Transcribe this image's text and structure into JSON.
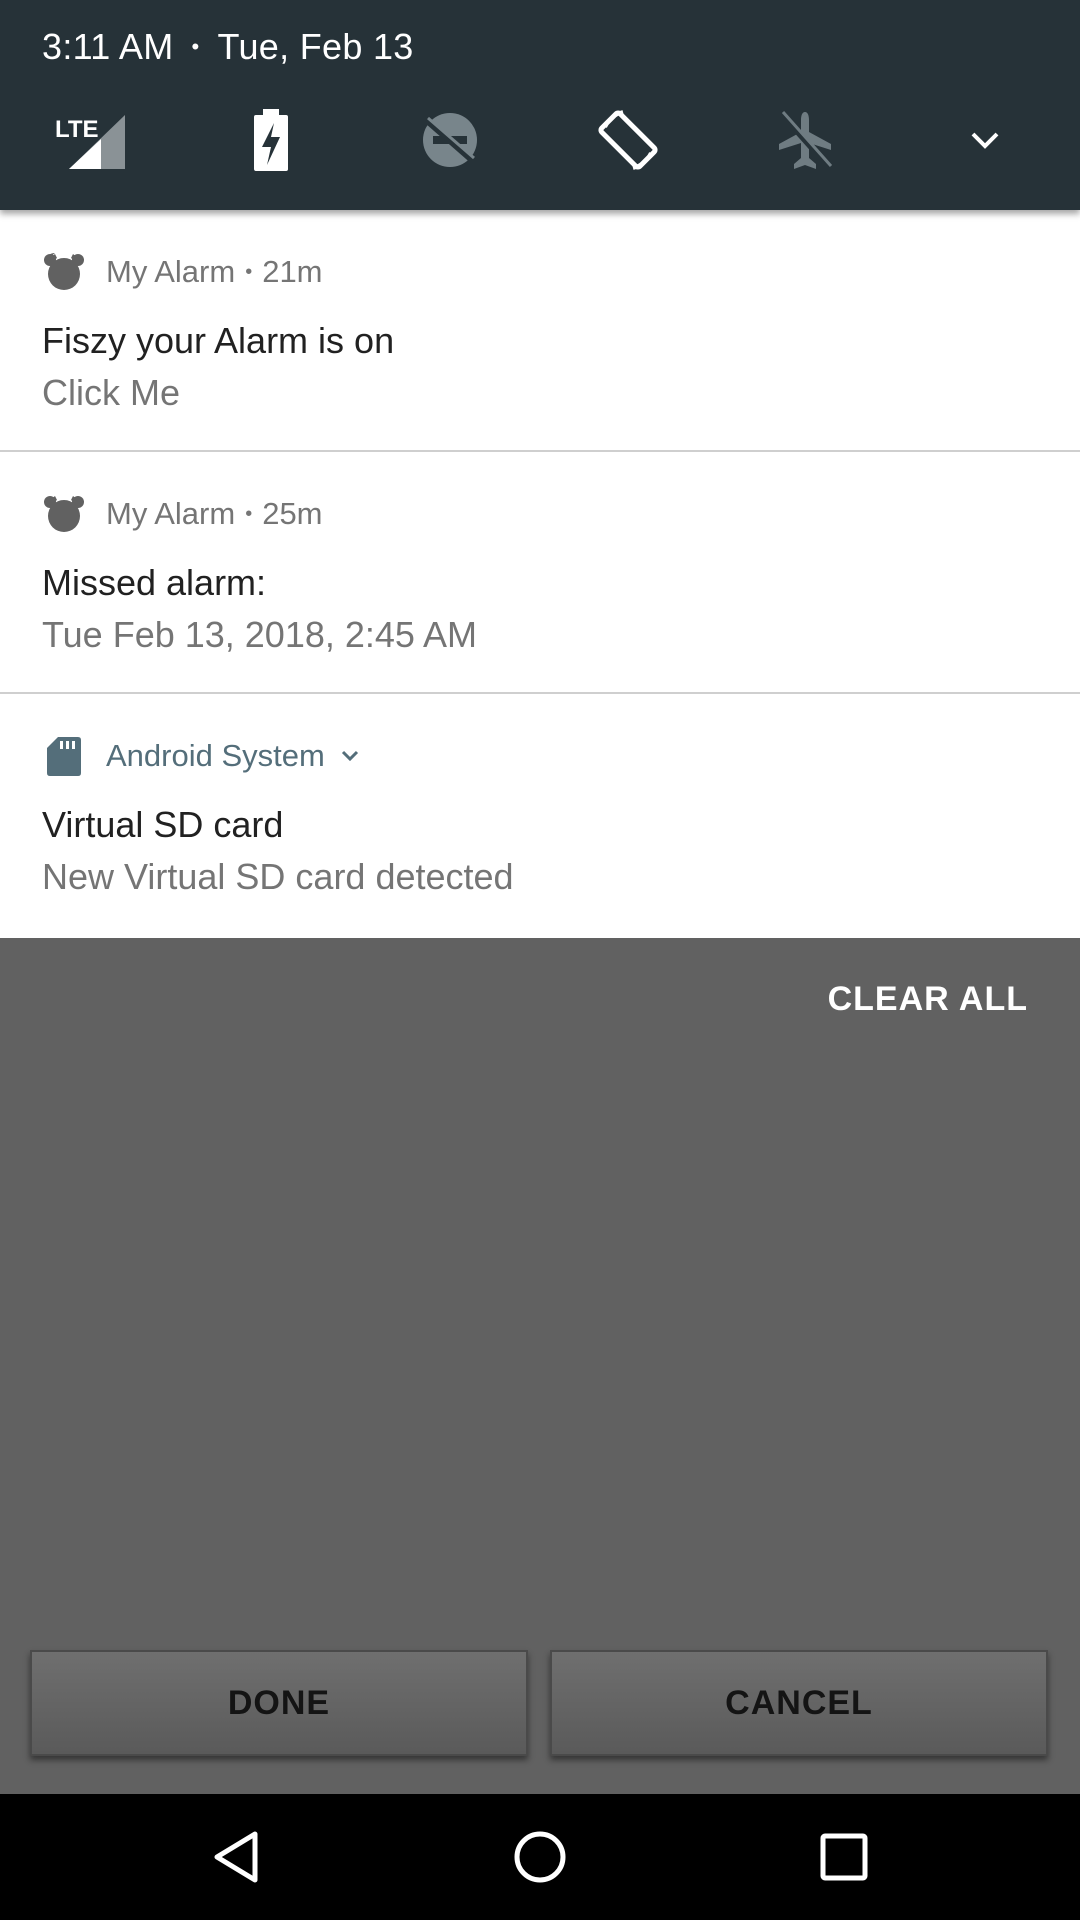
{
  "status": {
    "time": "3:11 AM",
    "separator": "•",
    "date": "Tue, Feb 13"
  },
  "quick_settings": {
    "tiles": [
      {
        "name": "signal-lte-icon",
        "label": "LTE"
      },
      {
        "name": "battery-charging-icon"
      },
      {
        "name": "do-not-disturb-off-icon"
      },
      {
        "name": "auto-rotate-icon"
      },
      {
        "name": "airplane-mode-off-icon"
      },
      {
        "name": "expand-chevron-icon"
      }
    ]
  },
  "notifications": [
    {
      "app": "My Alarm",
      "dot": "•",
      "time": "21m",
      "icon": "alarm-clock-icon",
      "title": "Fiszy your Alarm is on",
      "text": "Click Me"
    },
    {
      "app": "My Alarm",
      "dot": "•",
      "time": "25m",
      "icon": "alarm-clock-icon",
      "title": "Missed alarm:",
      "text": "Tue Feb 13, 2018, 2:45 AM"
    },
    {
      "app": "Android System",
      "icon": "sd-card-icon",
      "title": "Virtual SD card",
      "text": "New Virtual SD card detected"
    }
  ],
  "clear_all": "CLEAR ALL",
  "dialog": {
    "done": "DONE",
    "cancel": "CANCEL"
  },
  "nav": {
    "back": "back-icon",
    "home": "home-icon",
    "recents": "recents-icon"
  },
  "colors": {
    "header": "#263238",
    "scrim": "#616161",
    "system_accent": "#546e7a"
  }
}
